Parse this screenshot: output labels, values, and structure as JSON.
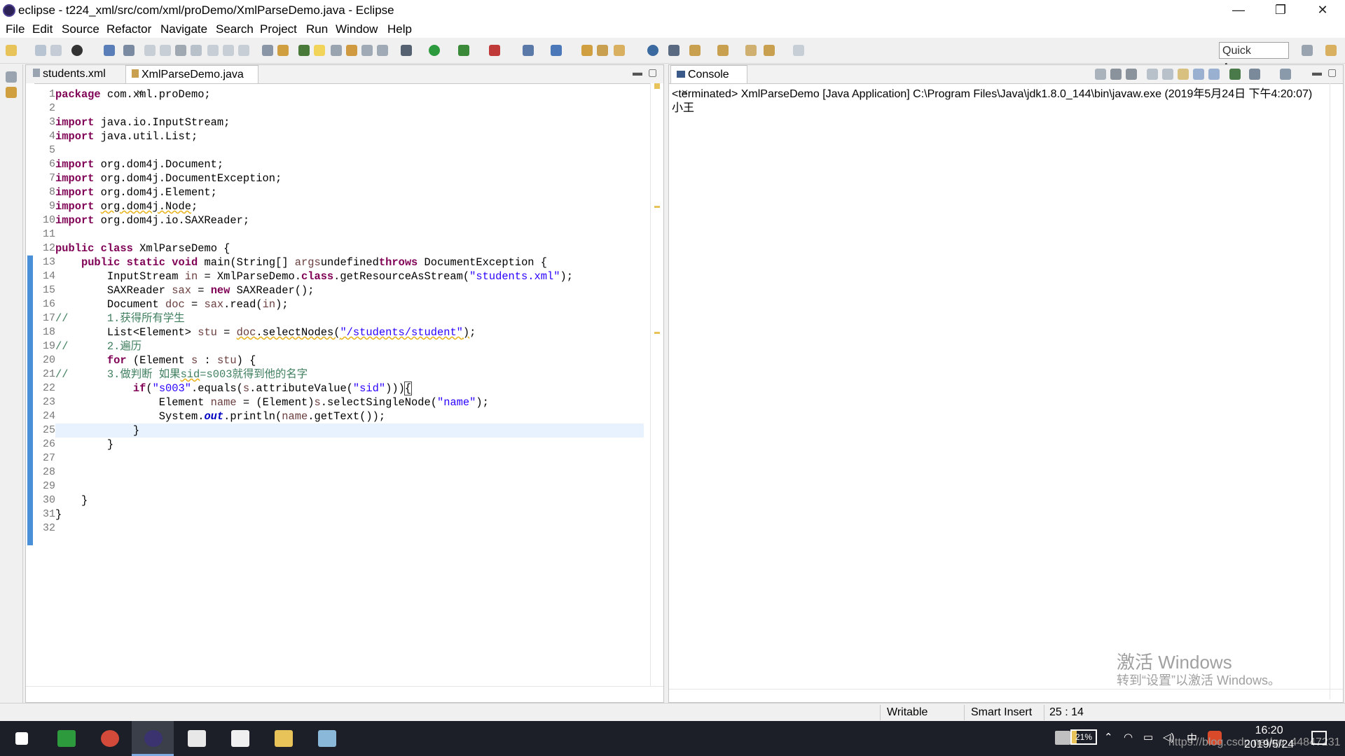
{
  "window": {
    "title": "eclipse - t224_xml/src/com/xml/proDemo/XmlParseDemo.java - Eclipse",
    "minimize": "—",
    "restore": "❐",
    "close": "✕"
  },
  "menu": [
    "File",
    "Edit",
    "Source",
    "Refactor",
    "Navigate",
    "Search",
    "Project",
    "Run",
    "Window",
    "Help"
  ],
  "toolbar": {
    "quick_access_placeholder": "Quick Access"
  },
  "editor": {
    "tabs": [
      {
        "label": "students.xml",
        "active": false
      },
      {
        "label": "XmlParseDemo.java",
        "active": true
      }
    ],
    "line_numbers": [
      "1",
      "2",
      "3",
      "4",
      "5",
      "6",
      "7",
      "8",
      "9",
      "10",
      "11",
      "12",
      "13",
      "14",
      "15",
      "16",
      "17",
      "18",
      "19",
      "20",
      "21",
      "22",
      "23",
      "24",
      "25",
      "26",
      "27",
      "28",
      "29",
      "30",
      "31",
      "32"
    ],
    "current_line": 25
  },
  "console": {
    "tab_label": "Console",
    "terminated": "<terminated> XmlParseDemo [Java Application] C:\\Program Files\\Java\\jdk1.8.0_144\\bin\\javaw.exe (2019年5月24日 下午4:20:07)",
    "output": "小王"
  },
  "watermark": {
    "line1": "激活 Windows",
    "line2": "转到“设置”以激活 Windows。"
  },
  "status": {
    "writable": "Writable",
    "insert_mode": "Smart Insert",
    "position": "25 : 14"
  },
  "taskbar": {
    "battery": "21%",
    "ime": "中",
    "time": "16:20",
    "date": "2019/5/24",
    "url_overlay": "https://blog.csdn.net/qq_44847231"
  }
}
